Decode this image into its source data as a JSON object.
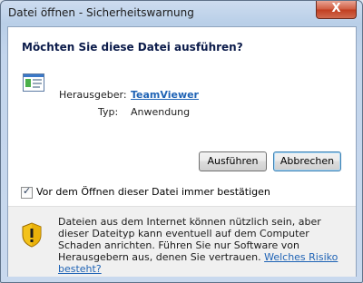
{
  "window": {
    "title": "Datei öffnen - Sicherheitswarnung",
    "close_glyph": "X"
  },
  "dialog": {
    "question": "Möchten Sie diese Datei ausführen?",
    "publisher_label": "Herausgeber:",
    "publisher_value": "TeamViewer",
    "type_label": "Typ:",
    "type_value": "Anwendung",
    "run_button": "Ausführen",
    "cancel_button": "Abbrechen",
    "checkbox_label": "Vor dem Öffnen dieser Datei immer bestätigen",
    "checkbox_checked": true
  },
  "warning": {
    "text": "Dateien aus dem Internet können nützlich sein, aber dieser Dateityp kann eventuell auf dem Computer Schaden anrichten. Führen Sie nur Software von Herausgebern aus, denen Sie vertrauen.",
    "link": "Welches Risiko besteht?"
  },
  "icons": {
    "app": "application-icon",
    "warning": "warning-shield-icon",
    "close": "close-icon"
  }
}
